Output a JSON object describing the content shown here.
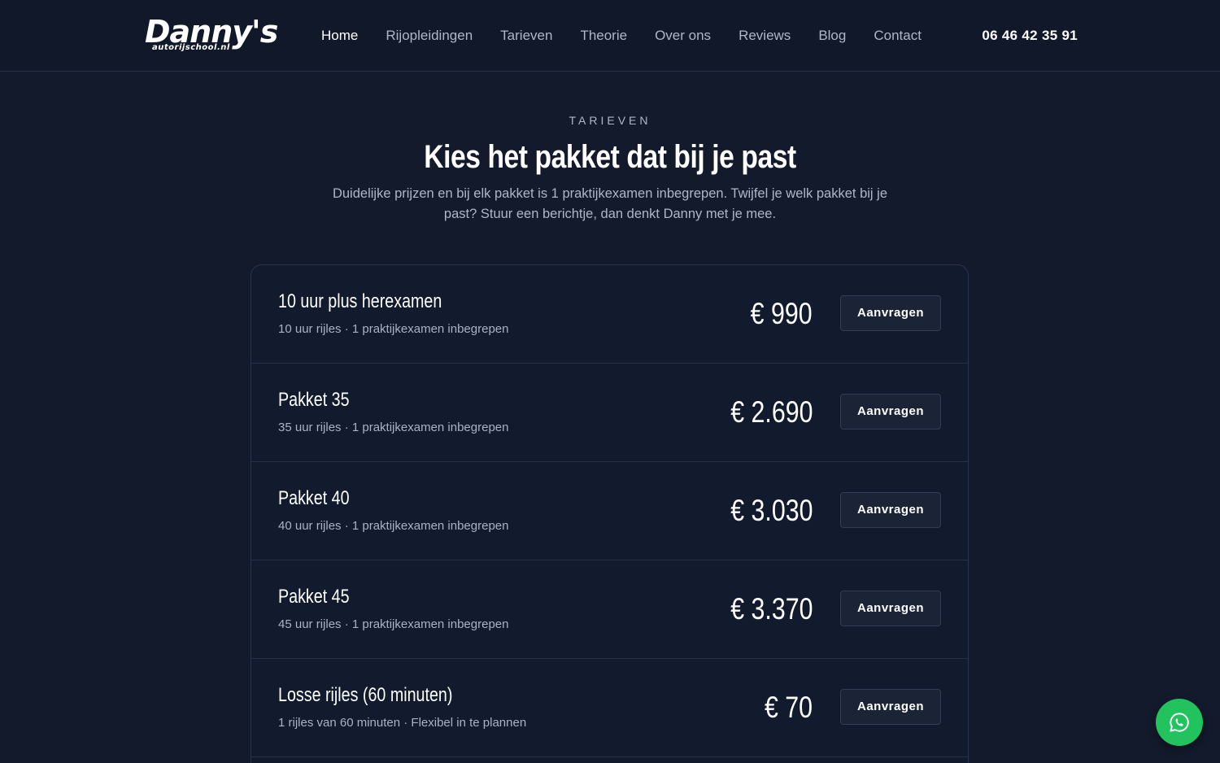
{
  "header": {
    "logo_main": "Danny's",
    "logo_sub": "autorijschool.nl",
    "nav": [
      {
        "label": "Home",
        "active": true
      },
      {
        "label": "Rijopleidingen",
        "active": false
      },
      {
        "label": "Tarieven",
        "active": false
      },
      {
        "label": "Theorie",
        "active": false
      },
      {
        "label": "Over ons",
        "active": false
      },
      {
        "label": "Reviews",
        "active": false
      },
      {
        "label": "Blog",
        "active": false
      },
      {
        "label": "Contact",
        "active": false
      }
    ],
    "phone": "06 46 42 35 91"
  },
  "section": {
    "eyebrow": "TARIEVEN",
    "title": "Kies het pakket dat bij je past",
    "subtitle": "Duidelijke prijzen en bij elk pakket is 1 praktijkexamen inbegrepen. Twijfel je welk pakket bij je past? Stuur een berichtje, dan denkt Danny met je mee."
  },
  "packages": [
    {
      "name": "10 uur plus herexamen",
      "desc": "10 uur rijles · 1 praktijkexamen inbegrepen",
      "price": "€ 990",
      "button": "Aanvragen"
    },
    {
      "name": "Pakket 35",
      "desc": "35 uur rijles · 1 praktijkexamen inbegrepen",
      "price": "€ 2.690",
      "button": "Aanvragen"
    },
    {
      "name": "Pakket 40",
      "desc": "40 uur rijles · 1 praktijkexamen inbegrepen",
      "price": "€ 3.030",
      "button": "Aanvragen"
    },
    {
      "name": "Pakket 45",
      "desc": "45 uur rijles · 1 praktijkexamen inbegrepen",
      "price": "€ 3.370",
      "button": "Aanvragen"
    },
    {
      "name": "Losse rijles (60 minuten)",
      "desc": "1 rijles van 60 minuten · Flexibel in te plannen",
      "price": "€ 70",
      "button": "Aanvragen"
    }
  ],
  "colors": {
    "background": "#131a2c",
    "accent_whatsapp": "#22c35e"
  },
  "icons": {
    "floating_button": "whatsapp-icon"
  }
}
